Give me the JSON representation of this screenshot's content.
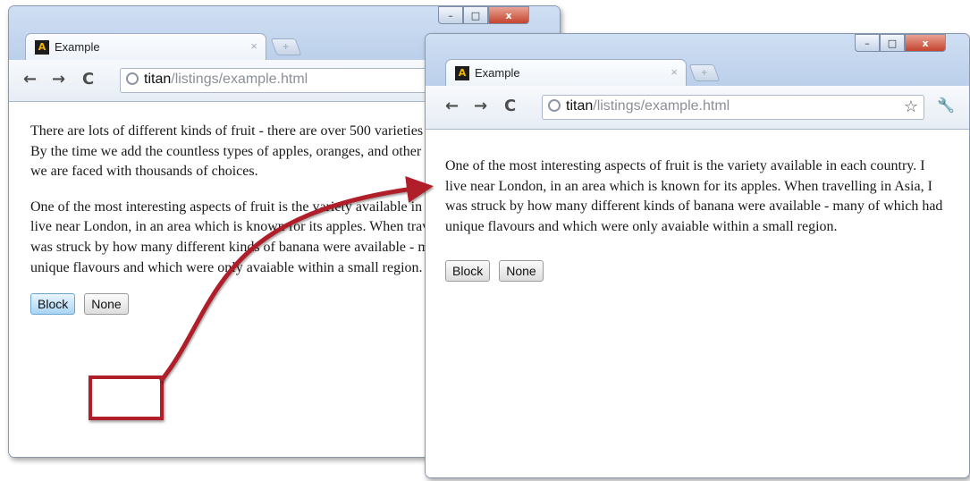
{
  "left_window": {
    "tab_title": "Example",
    "tab_close": "×",
    "url_host": "titan",
    "url_path": "/listings/example.html",
    "paragraph1": "There are lots of different kinds of fruit - there are over 500 varieties of banana alone. By the time we add the countless types of apples, oranges, and other well-known fruit, we are faced with thousands of choices.",
    "paragraph2": "One of the most interesting aspects of fruit is the variety available in each country. I live near London, in an area which is known for its apples. When travelling in Asia, I was struck by how many different kinds of banana were available - many of which had unique flavours and which were only avaiable within a small region.",
    "block_button": "Block",
    "none_button": "None"
  },
  "right_window": {
    "tab_title": "Example",
    "tab_close": "×",
    "url_host": "titan",
    "url_path": "/listings/example.html",
    "paragraph": "One of the most interesting aspects of fruit is the variety available in each country. I live near London, in an area which is known for its apples. When travelling in Asia, I was struck by how many different kinds of banana were available - many of which had unique flavours and which were only avaiable within a small region.",
    "block_button": "Block",
    "none_button": "None"
  },
  "icons": {
    "back": "←",
    "forward": "→",
    "reload": "C",
    "star": "☆",
    "wrench": "🔧",
    "new_tab": "+",
    "favicon": "A",
    "minimize": "–",
    "maximize": "□",
    "close": "x"
  },
  "colors": {
    "highlight_box": "#b01e2a",
    "arrow": "#b01e2a",
    "block_button_accent": "#a9d4f3"
  }
}
